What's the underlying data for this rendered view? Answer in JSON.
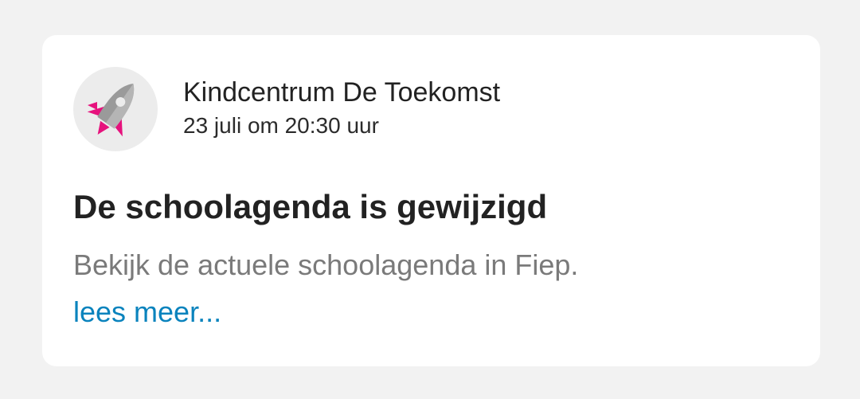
{
  "post": {
    "organization": "Kindcentrum De Toekomst",
    "timestamp": "23 juli om 20:30 uur",
    "title": "De schoolagenda is gewijzigd",
    "body": "Bekijk de actuele schoolagenda in Fiep.",
    "read_more": "lees meer..."
  },
  "avatar": {
    "icon": "rocket-icon"
  },
  "colors": {
    "background": "#f2f2f2",
    "card": "#ffffff",
    "link": "#0a83bd",
    "muted_text": "#7a7a7a",
    "rocket_accent": "#e6127d",
    "rocket_body": "#9a9a9a"
  }
}
